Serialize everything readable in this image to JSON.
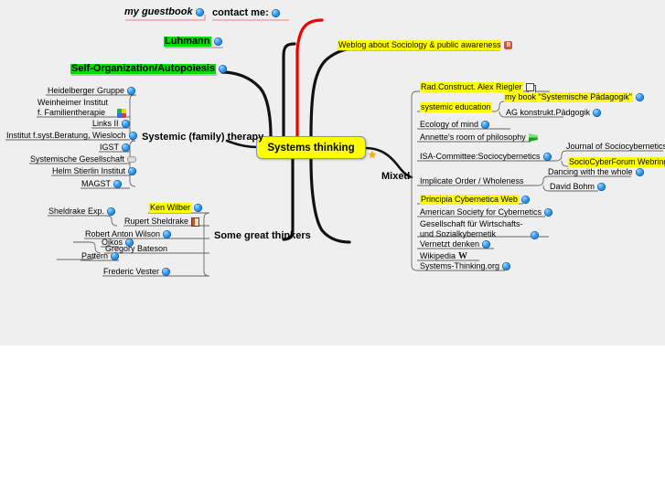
{
  "app": {
    "canvas_bg": "#efefef",
    "page_bg": "#ffffff",
    "accent_yellow": "#ffff00",
    "accent_green": "#00dd00",
    "accent_red": "#ee0000",
    "root_border": "#8a8ad0"
  },
  "root": {
    "label": "Systems thinking",
    "star_icon": "star-icon"
  },
  "branches": {
    "contact": {
      "label": "contact me:",
      "icon": "globe-icon",
      "children": [
        {
          "label": "my guestbook",
          "icon": "globe-icon",
          "style": "italic"
        }
      ]
    },
    "luhmann": {
      "label": "Luhmann",
      "icon": "globe-icon",
      "highlight": "green"
    },
    "self_organization": {
      "label": "Self-Organization/Autopoiesis",
      "icon": "globe-icon",
      "highlight": "green"
    },
    "weblog": {
      "label": "Weblog about Sociology & public awareness",
      "icon": "blogger-icon",
      "highlight": "yellow"
    },
    "systemic_therapy": {
      "label": "Systemic (family) therapy",
      "children": [
        {
          "label": "Heidelberger Gruppe",
          "icon": "globe-icon"
        },
        {
          "label": "Weinheimer Institut f. Familientherapie",
          "icon": "pinwheel-icon",
          "lines": 2
        },
        {
          "label": "Links II",
          "icon": "globe-icon"
        },
        {
          "label": "Institut f.syst.Beratung, Wiesloch",
          "icon": "globe-icon"
        },
        {
          "label": "IGST",
          "icon": "globe-icon"
        },
        {
          "label": "Systemische Gesellschaft",
          "icon": "grey-icon"
        },
        {
          "label": "Helm Stierlin  Institut",
          "icon": "globe-icon"
        },
        {
          "label": "MAGST",
          "icon": "globe-icon"
        }
      ]
    },
    "great_thinkers": {
      "label": "Some great thinkers",
      "children": [
        {
          "label": "Ken Wilber",
          "icon": "globe-icon",
          "highlight": "yellow"
        },
        {
          "label": "Rupert Sheldrake",
          "icon": "book-icon",
          "children": [
            {
              "label": "Sheldrake Exp.",
              "icon": "globe-icon"
            }
          ]
        },
        {
          "label": "Robert Anton Wilson",
          "icon": "globe-icon"
        },
        {
          "label": "Gregory Bateson",
          "children": [
            {
              "label": "Oikos",
              "icon": "globe-icon"
            },
            {
              "label": "Pattern",
              "icon": "globe-icon"
            }
          ]
        },
        {
          "label": "Frederic Vester",
          "icon": "globe-icon"
        }
      ]
    },
    "mixed": {
      "label": "Mixed",
      "children": [
        {
          "label": "Rad.Construct. Alex Riegler",
          "icon": "copy-icon",
          "highlight": "yellow"
        },
        {
          "label": "systemic education",
          "highlight": "yellow",
          "children": [
            {
              "label": "my book \"Systemische Pädagogik\"",
              "icon": "globe-icon",
              "highlight": "yellow"
            },
            {
              "label": "AG konstrukt.Pädgogik",
              "icon": "globe-icon"
            }
          ]
        },
        {
          "label": "Ecology of mind",
          "icon": "globe-icon"
        },
        {
          "label": "Annette's room of philosophy",
          "icon": "flag-icon"
        },
        {
          "label": "ISA-Committee:Sociocybernetics",
          "icon": "globe-icon",
          "children": [
            {
              "label": "Journal of Sociocybernetics",
              "icon": "globe-icon"
            },
            {
              "label": "SocioCyberForum Webring",
              "icon": "globe-icon",
              "highlight": "yellow"
            }
          ]
        },
        {
          "label": "Implicate Order / Wholeness",
          "children": [
            {
              "label": "Dancing with the whole",
              "icon": "globe-icon"
            },
            {
              "label": "David Bohm",
              "icon": "globe-icon"
            }
          ]
        },
        {
          "label": "Principia Cybernetica Web",
          "icon": "globe-icon",
          "highlight": "yellow"
        },
        {
          "label": "American Society for Cybernetics",
          "icon": "globe-icon"
        },
        {
          "label": "Gesellschaft für Wirtschafts- und Sozialkybernetik",
          "icon": "globe-icon",
          "lines": 2
        },
        {
          "label": "Vernetzt denken",
          "icon": "globe-icon"
        },
        {
          "label": "Wikipedia",
          "icon": "wiki-icon"
        },
        {
          "label": "Systems-Thinking.org",
          "icon": "globe-icon"
        }
      ]
    }
  }
}
